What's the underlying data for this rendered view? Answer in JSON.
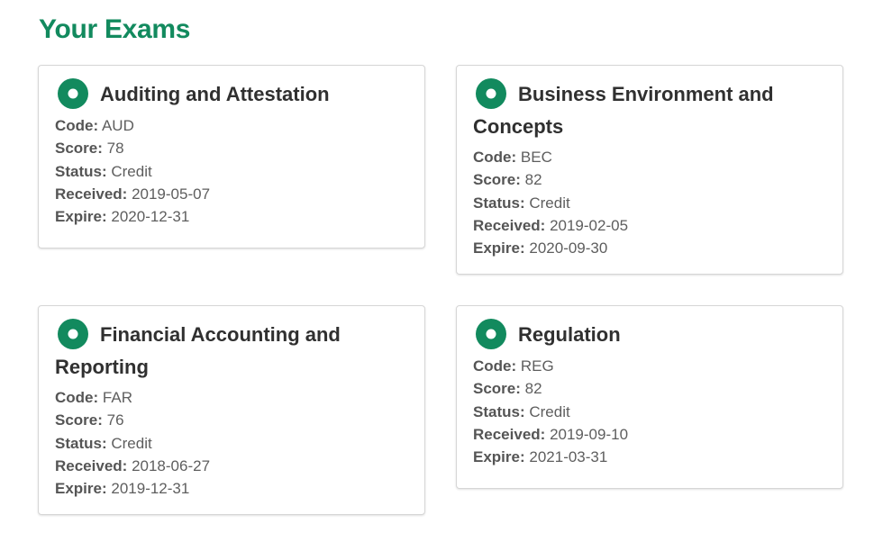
{
  "page": {
    "title": "Your Exams"
  },
  "colors": {
    "accent": "#128a5e",
    "card_border": "#d6d6d6"
  },
  "labels": {
    "code": "Code:",
    "score": "Score:",
    "status": "Status:",
    "received": "Received:",
    "expire": "Expire:"
  },
  "exams": [
    {
      "icon": "status-circle-icon",
      "title": "Auditing and Attestation",
      "code": "AUD",
      "score": "78",
      "status": "Credit",
      "received": "2019-05-07",
      "expire": "2020-12-31"
    },
    {
      "icon": "status-circle-icon",
      "title": "Business Environment and Concepts",
      "code": "BEC",
      "score": "82",
      "status": "Credit",
      "received": "2019-02-05",
      "expire": "2020-09-30"
    },
    {
      "icon": "status-circle-icon",
      "title": "Financial Accounting and Reporting",
      "code": "FAR",
      "score": "76",
      "status": "Credit",
      "received": "2018-06-27",
      "expire": "2019-12-31"
    },
    {
      "icon": "status-circle-icon",
      "title": "Regulation",
      "code": "REG",
      "score": "82",
      "status": "Credit",
      "received": "2019-09-10",
      "expire": "2021-03-31"
    }
  ]
}
